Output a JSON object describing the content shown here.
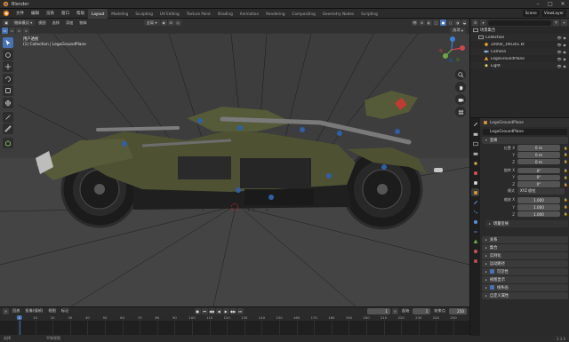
{
  "titlebar": {
    "title": "Blender",
    "min": "–",
    "max": "□",
    "close": "✕"
  },
  "menu": [
    "文件",
    "编辑",
    "渲染",
    "窗口",
    "帮助"
  ],
  "workspaces": [
    {
      "label": "Layout",
      "active": true
    },
    {
      "label": "Modeling"
    },
    {
      "label": "Sculpting"
    },
    {
      "label": "UV Editing"
    },
    {
      "label": "Texture Paint"
    },
    {
      "label": "Shading"
    },
    {
      "label": "Animation"
    },
    {
      "label": "Rendering"
    },
    {
      "label": "Compositing"
    },
    {
      "label": "Geometry Nodes"
    },
    {
      "label": "Scripting"
    }
  ],
  "topright": {
    "scene": "Scene",
    "viewlayer": "ViewLayer"
  },
  "viewport_header": {
    "mode": "物体模式",
    "menus": [
      "视图",
      "选择",
      "添加",
      "物体"
    ],
    "transform": "全局",
    "options": "选项"
  },
  "viewport_info": {
    "line1": "用户透视",
    "line2": "(1) Collection | LegoGroundPlane"
  },
  "timeline": {
    "menus": [
      "回放",
      "抠像(插帧)",
      "视图",
      "标记"
    ],
    "current_frame": "1",
    "start_label": "起始",
    "start": "1",
    "end_label": "结束点",
    "end": "250",
    "ticks": [
      "0",
      "10",
      "20",
      "30",
      "40",
      "50",
      "60",
      "70",
      "80",
      "90",
      "100",
      "110",
      "120",
      "130",
      "140",
      "150",
      "160",
      "170",
      "180",
      "190",
      "200",
      "210",
      "220",
      "230",
      "240",
      "250"
    ],
    "tick_current": "1"
  },
  "statusbar": {
    "left": "选择",
    "mid": "平移视图",
    "right": "3.3.0"
  },
  "outliner": {
    "rows": [
      {
        "label": "场景集合",
        "indent": 0,
        "icon": "collection"
      },
      {
        "label": "Collection",
        "indent": 1,
        "icon": "collection"
      },
      {
        "label": "20000_190301.kt",
        "indent": 2,
        "icon": "object"
      },
      {
        "label": "Camera",
        "indent": 2,
        "icon": "camera"
      },
      {
        "label": "LegoGroundPlane",
        "indent": 2,
        "icon": "mesh"
      },
      {
        "label": "Light",
        "indent": 2,
        "icon": "light"
      }
    ]
  },
  "properties": {
    "object_title": "LegoGroundPlane",
    "object_name": "LegoGroundPlane",
    "transform_header": "变换",
    "location_label": "位置 X",
    "location": [
      "0 m",
      "0 m",
      "0 m"
    ],
    "rotation_label": "旋转 X",
    "rotation": [
      "0°",
      "0°",
      "0°"
    ],
    "mode_label": "模式",
    "mode_value": "XYZ 欧拉",
    "scale_label": "缩放 X",
    "scale": [
      "1.000",
      "1.000",
      "1.000"
    ],
    "axis_y": "Y",
    "axis_z": "Z",
    "delta_header": "增量变换",
    "panels": [
      "关系",
      "集合",
      "实例化",
      "运动路径",
      "可见性",
      "视图显示",
      "线条画",
      "自定义属性"
    ],
    "visibility_checked": "可见性",
    "line_art_checked": "线条画"
  },
  "colors": {
    "accent": "#4772b3",
    "viewport_bg": "#3d3d3d",
    "vehicle_body": "#4e5233",
    "vehicle_dark": "#1e1e1e",
    "blue_parts": "#2f5fa8",
    "red_part": "#c23a34"
  }
}
